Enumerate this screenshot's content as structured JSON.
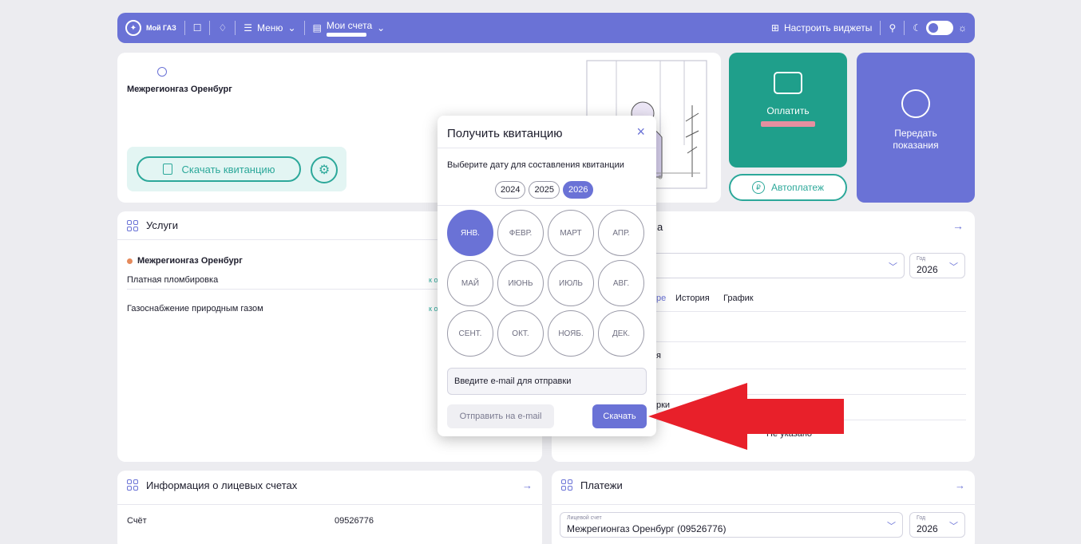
{
  "topbar": {
    "logo": "Мой ГАЗ",
    "menu": "Меню",
    "accounts": "Мои счета",
    "widgets": "Настроить виджеты"
  },
  "supplier": {
    "name": "Межрегионгаз Оренбург",
    "download_button": "Скачать квитанцию"
  },
  "tiles": {
    "pay": "Оплатить",
    "autopay": "Автоплатеж",
    "meter": "Передать\nпоказания"
  },
  "services": {
    "title": "Услуги",
    "provider": "Межрегионгаз Оренбург",
    "rows": [
      {
        "name": "Платная пломбировка",
        "status": "к оп"
      },
      {
        "name": "Газоснабжение природным газом",
        "status": "к оп"
      }
    ]
  },
  "right_card": {
    "title_tail": "а",
    "year_label": "Год",
    "year_value": "2026",
    "tabs": [
      "ре",
      "История",
      "График"
    ],
    "row_text_1": "я",
    "row_text_2": "рки",
    "not_specified": "Не указано"
  },
  "accounts": {
    "title": "Информация о лицевых счетах",
    "account_label": "Счёт",
    "account_number": "09526776"
  },
  "payments": {
    "title": "Платежи",
    "account_label": "Лицевой счет",
    "account_value": "Межрегионгаз Оренбург (09526776)",
    "year_label": "Год",
    "year_value": "2026"
  },
  "dialog": {
    "title": "Получить квитанцию",
    "close": "×",
    "subtitle": "Выберите дату для составления квитанции",
    "years": [
      {
        "label": "2024",
        "active": false
      },
      {
        "label": "2025",
        "active": false
      },
      {
        "label": "2026",
        "active": true
      }
    ],
    "months": [
      {
        "label": "ЯНВ.",
        "active": true
      },
      {
        "label": "ФЕВР.",
        "active": false
      },
      {
        "label": "МАРТ",
        "active": false
      },
      {
        "label": "АПР.",
        "active": false
      },
      {
        "label": "МАЙ",
        "active": false
      },
      {
        "label": "ИЮНЬ",
        "active": false
      },
      {
        "label": "ИЮЛЬ",
        "active": false
      },
      {
        "label": "АВГ.",
        "active": false
      },
      {
        "label": "СЕНТ.",
        "active": false
      },
      {
        "label": "ОКТ.",
        "active": false
      },
      {
        "label": "НОЯБ.",
        "active": false
      },
      {
        "label": "ДЕК.",
        "active": false
      }
    ],
    "email_placeholder": "Введите e-mail для отправки",
    "send_button": "Отправить на e-mail",
    "download_button": "Скачать"
  },
  "colors": {
    "accent": "#6a72d6",
    "teal": "#1f9f8b",
    "arrow": "#e8202a"
  }
}
